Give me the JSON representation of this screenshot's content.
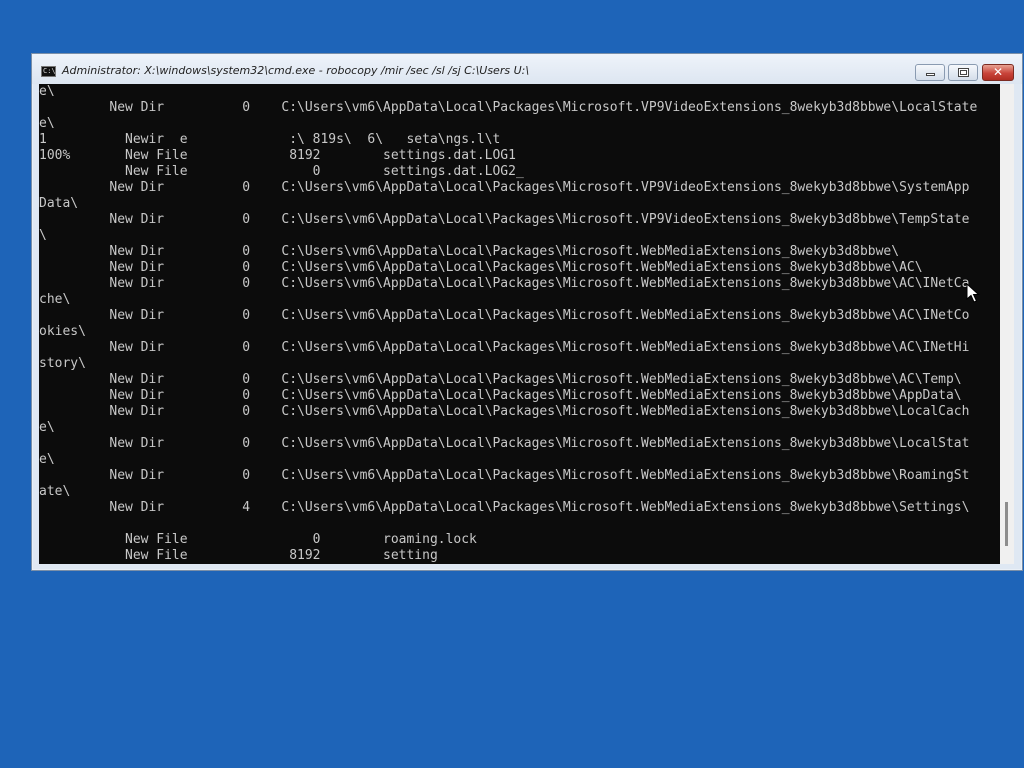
{
  "window": {
    "title": "Administrator: X:\\windows\\system32\\cmd.exe - robocopy  /mir /sec /sl /sj C:\\Users U:\\",
    "icon_label": "C:\\"
  },
  "console_lines": [
    "e\\",
    "         New Dir          0    C:\\Users\\vm6\\AppData\\Local\\Packages\\Microsoft.VP9VideoExtensions_8wekyb3d8bbwe\\LocalState",
    "e\\",
    "1          Newir  e             :\\ 819s\\  6\\   seta\\ngs.l\\t",
    "100%       New File             8192        settings.dat.LOG1",
    "           New File                0        settings.dat.LOG2_",
    "         New Dir          0    C:\\Users\\vm6\\AppData\\Local\\Packages\\Microsoft.VP9VideoExtensions_8wekyb3d8bbwe\\SystemApp",
    "Data\\",
    "         New Dir          0    C:\\Users\\vm6\\AppData\\Local\\Packages\\Microsoft.VP9VideoExtensions_8wekyb3d8bbwe\\TempState",
    "\\",
    "         New Dir          0    C:\\Users\\vm6\\AppData\\Local\\Packages\\Microsoft.WebMediaExtensions_8wekyb3d8bbwe\\",
    "         New Dir          0    C:\\Users\\vm6\\AppData\\Local\\Packages\\Microsoft.WebMediaExtensions_8wekyb3d8bbwe\\AC\\",
    "         New Dir          0    C:\\Users\\vm6\\AppData\\Local\\Packages\\Microsoft.WebMediaExtensions_8wekyb3d8bbwe\\AC\\INetCa",
    "che\\",
    "         New Dir          0    C:\\Users\\vm6\\AppData\\Local\\Packages\\Microsoft.WebMediaExtensions_8wekyb3d8bbwe\\AC\\INetCo",
    "okies\\",
    "         New Dir          0    C:\\Users\\vm6\\AppData\\Local\\Packages\\Microsoft.WebMediaExtensions_8wekyb3d8bbwe\\AC\\INetHi",
    "story\\",
    "         New Dir          0    C:\\Users\\vm6\\AppData\\Local\\Packages\\Microsoft.WebMediaExtensions_8wekyb3d8bbwe\\AC\\Temp\\",
    "         New Dir          0    C:\\Users\\vm6\\AppData\\Local\\Packages\\Microsoft.WebMediaExtensions_8wekyb3d8bbwe\\AppData\\",
    "         New Dir          0    C:\\Users\\vm6\\AppData\\Local\\Packages\\Microsoft.WebMediaExtensions_8wekyb3d8bbwe\\LocalCach",
    "e\\",
    "         New Dir          0    C:\\Users\\vm6\\AppData\\Local\\Packages\\Microsoft.WebMediaExtensions_8wekyb3d8bbwe\\LocalStat",
    "e\\",
    "         New Dir          0    C:\\Users\\vm6\\AppData\\Local\\Packages\\Microsoft.WebMediaExtensions_8wekyb3d8bbwe\\RoamingSt",
    "ate\\",
    "         New Dir          4    C:\\Users\\vm6\\AppData\\Local\\Packages\\Microsoft.WebMediaExtensions_8wekyb3d8bbwe\\Settings\\",
    "",
    "           New File                0        roaming.lock",
    "           New File             8192        setting"
  ],
  "colors": {
    "desktop": "#1e64b8",
    "console_bg": "#0c0c0c",
    "console_fg": "#c8c8c8",
    "close_button": "#c9443a"
  },
  "icons": [
    "cmd-icon",
    "minimize-icon",
    "maximize-icon",
    "close-icon",
    "mouse-pointer-icon"
  ]
}
